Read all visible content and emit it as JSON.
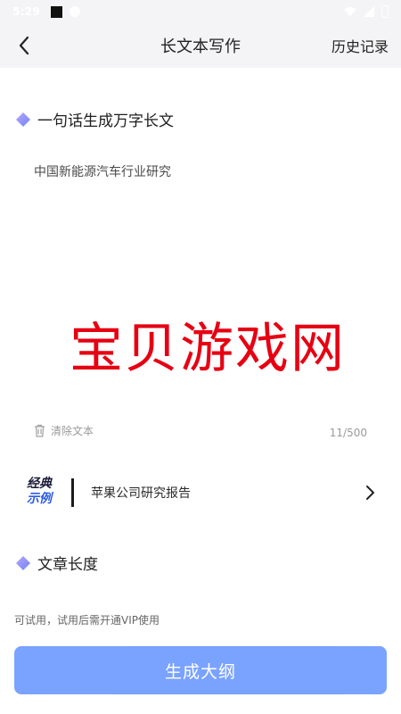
{
  "status_bar": {
    "time": "5:29"
  },
  "header": {
    "title": "长文本写作",
    "history_label": "历史记录"
  },
  "section_prompt": {
    "label": "一句话生成万字长文",
    "input_value": "中国新能源汽车行业研究"
  },
  "watermark": "宝贝游戏网",
  "clear": {
    "label": "清除文本",
    "count": "11/500"
  },
  "example": {
    "badge_line1": "经典",
    "badge_line2": "示例",
    "text": "苹果公司研究报告"
  },
  "section_length": {
    "label": "文章长度"
  },
  "hint": "可试用，试用后需开通VIP使用",
  "primary_button": "生成大纲",
  "colors": {
    "accent": "#6f9bff",
    "section_diamond": "#8a7cf5",
    "watermark": "#e60012",
    "badge_blue": "#2d5be3"
  }
}
